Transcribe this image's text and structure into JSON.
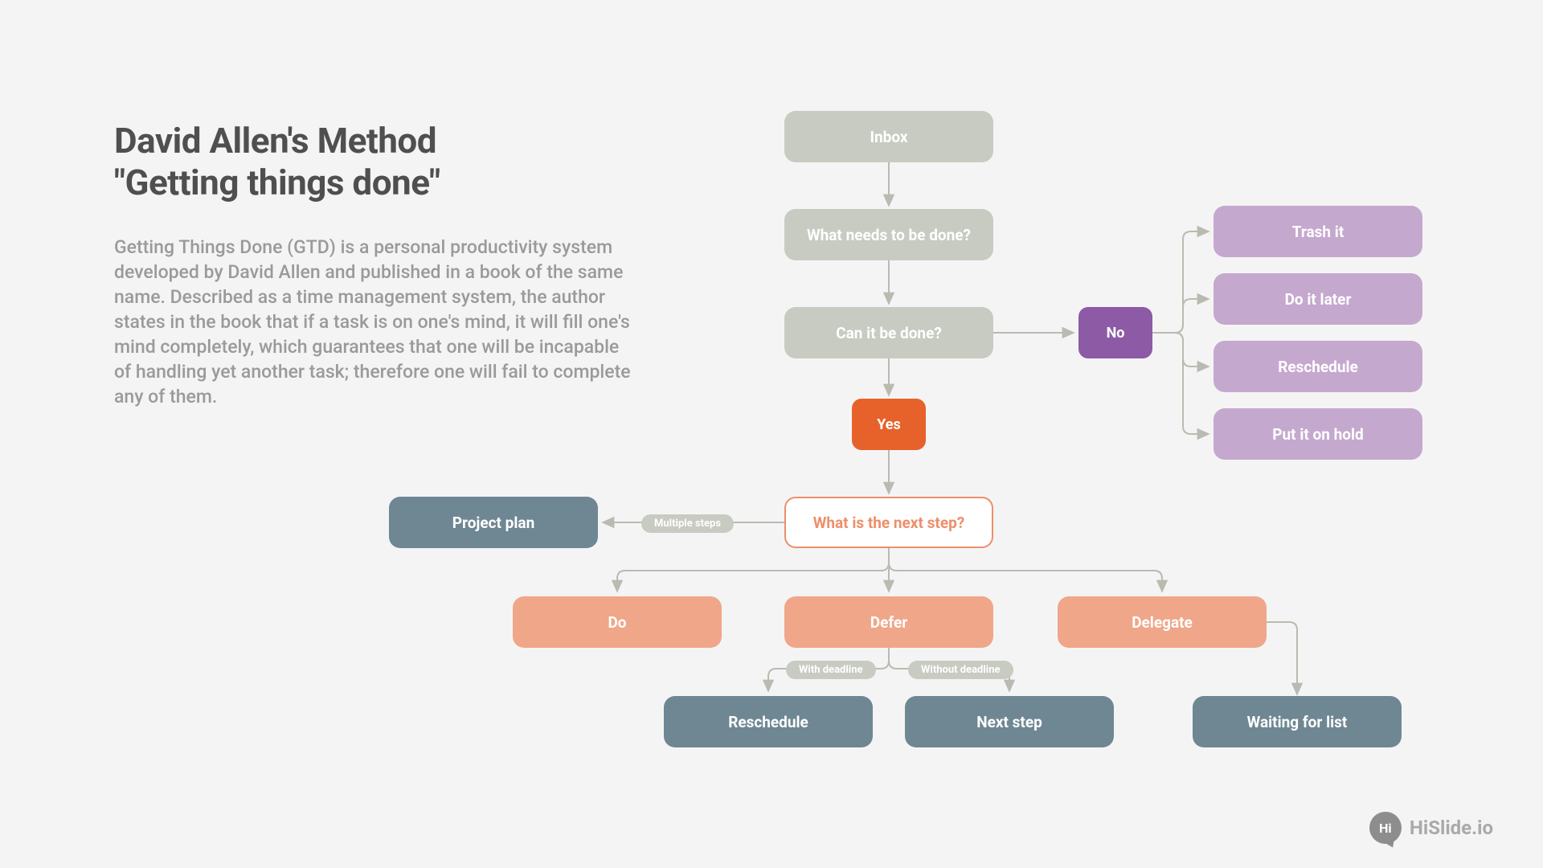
{
  "title_line1": "David Allen's Method",
  "title_line2": "\"Getting things done\"",
  "description": "Getting Things Done (GTD) is a personal productivity system developed by David Allen and published in a book of the same name. Described as a time management system, the author states in the book that if a task is on one's mind, it will fill one's mind completely, which guarantees that one will be incapable of handling yet another task; therefore one will fail to complete any of them.",
  "nodes": {
    "inbox": "Inbox",
    "what_needs": "What needs to be done?",
    "can_done": "Can it be done?",
    "no": "No",
    "yes": "Yes",
    "trash": "Trash it",
    "later": "Do it later",
    "reschedule_top": "Reschedule",
    "hold": "Put it on hold",
    "next_step_q": "What is the next step?",
    "project_plan": "Project plan",
    "do": "Do",
    "defer": "Defer",
    "delegate": "Delegate",
    "reschedule_bot": "Reschedule",
    "next_step": "Next step",
    "waiting": "Waiting for list"
  },
  "pills": {
    "multiple": "Multiple steps",
    "with_dl": "With deadline",
    "without_dl": "Without deadline"
  },
  "brand": {
    "badge": "Hi",
    "name": "HiSlide.io"
  },
  "colors": {
    "bg": "#f5f4f5",
    "grey": "#c8cbc1",
    "purple": "#8d5aa5",
    "orange": "#e6622a",
    "lavender": "#c5a8ce",
    "orange_light": "#f0a689",
    "slate": "#6e8793",
    "arrow": "#b9bbb1"
  }
}
